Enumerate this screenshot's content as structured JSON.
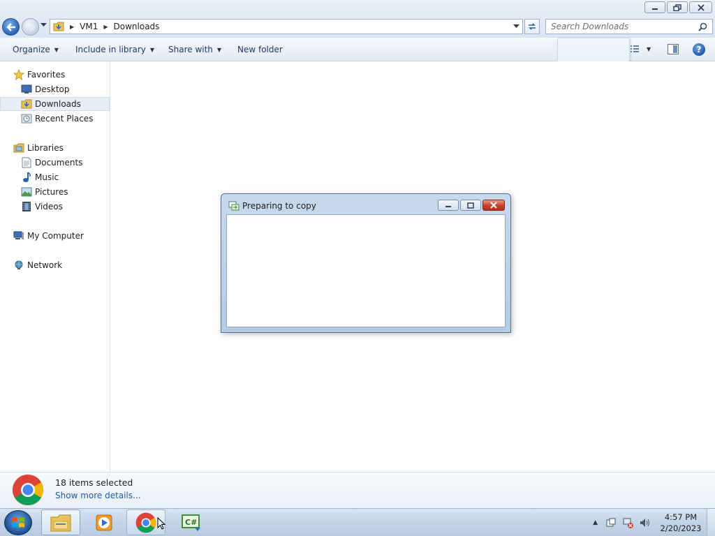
{
  "window": {
    "title": "Downloads",
    "caption_buttons": [
      "minimize",
      "restore",
      "close"
    ]
  },
  "address_bar": {
    "breadcrumb": [
      "VM1",
      "Downloads"
    ],
    "search_placeholder": "Search Downloads"
  },
  "command_bar": {
    "organize": "Organize",
    "include_in_library": "Include in library",
    "share_with": "Share with",
    "new_folder": "New folder",
    "view_icon": "view-options-icon",
    "preview_icon": "preview-pane-icon",
    "help_label": "?"
  },
  "nav_pane": {
    "favorites": {
      "label": "Favorites",
      "items": [
        {
          "label": "Desktop",
          "icon": "desktop-icon"
        },
        {
          "label": "Downloads",
          "icon": "downloads-folder-icon",
          "selected": true
        },
        {
          "label": "Recent Places",
          "icon": "recent-places-icon"
        }
      ]
    },
    "libraries": {
      "label": "Libraries",
      "items": [
        {
          "label": "Documents",
          "icon": "documents-icon"
        },
        {
          "label": "Music",
          "icon": "music-icon"
        },
        {
          "label": "Pictures",
          "icon": "pictures-icon"
        },
        {
          "label": "Videos",
          "icon": "videos-icon"
        }
      ]
    },
    "computer": {
      "label": "My Computer",
      "icon": "computer-icon"
    },
    "network": {
      "label": "Network",
      "icon": "network-icon"
    }
  },
  "details_pane": {
    "selection_count": "18 items selected",
    "more_details_link": "Show more details..."
  },
  "copy_dialog": {
    "title": "Preparing to copy"
  },
  "taskbar": {
    "apps": [
      {
        "name": "windows-explorer",
        "icon": "folder-icon",
        "active": true
      },
      {
        "name": "media-player",
        "icon": "media-player-icon",
        "active": false
      },
      {
        "name": "google-chrome",
        "icon": "chrome-icon",
        "active": false
      },
      {
        "name": "csharp-editor",
        "icon": "csharp-icon",
        "active": false
      }
    ],
    "tray_icons": [
      "action-center-icon",
      "network-tray-icon",
      "volume-icon"
    ],
    "clock": {
      "time": "4:57 PM",
      "date": "2/20/2023"
    }
  },
  "colors": {
    "accent": "#1d5aa8",
    "selection": "#e8eef5",
    "dialog_close": "#c7402a"
  }
}
